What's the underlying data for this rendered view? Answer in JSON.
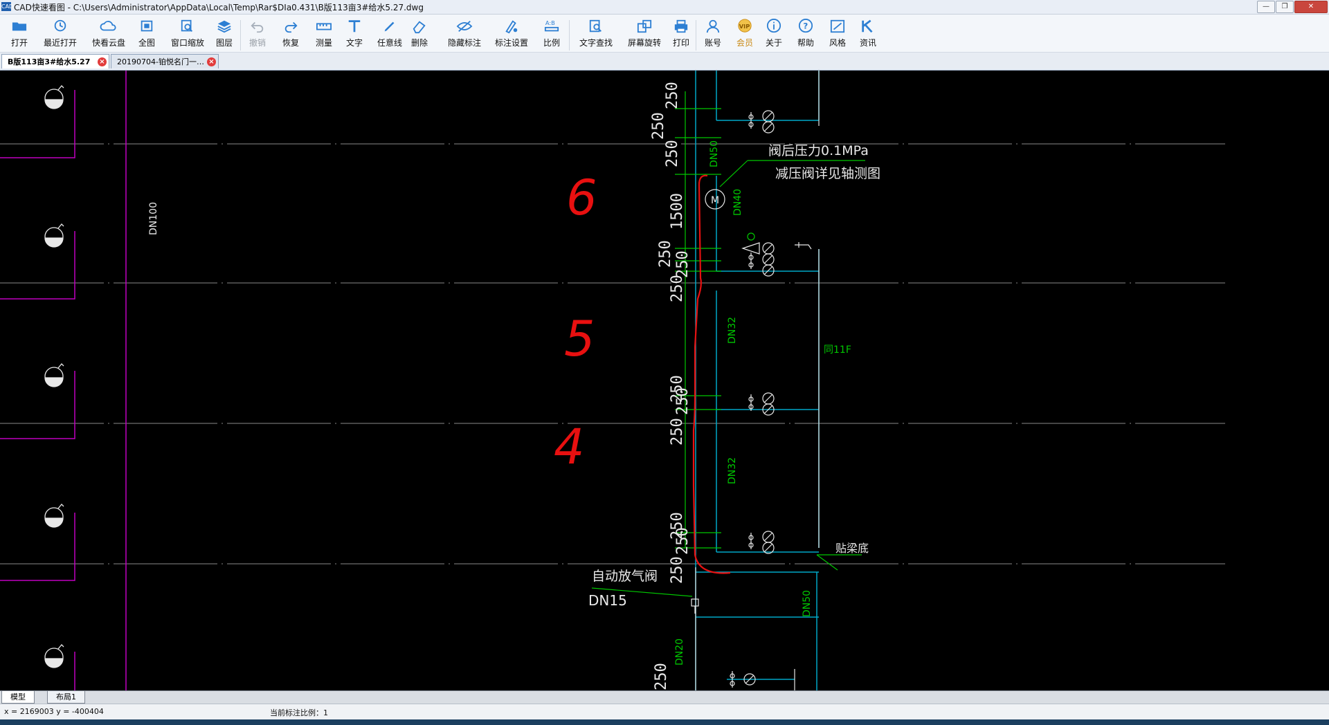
{
  "window": {
    "app_icon": "CAD",
    "title": "CAD快速看图 - C:\\Users\\Administrator\\AppData\\Local\\Temp\\Rar$DIa0.431\\B版113亩3#给水5.27.dwg",
    "buttons": {
      "minimize": "—",
      "restore": "❐",
      "close": "✕"
    }
  },
  "toolbar": [
    {
      "id": "open",
      "label": "打开",
      "icon": "folder-icon"
    },
    {
      "id": "recent",
      "label": "最近打开",
      "icon": "history-icon"
    },
    {
      "id": "cloud",
      "label": "快看云盘",
      "icon": "cloud-icon"
    },
    {
      "id": "fullview",
      "label": "全图",
      "icon": "fullview-icon"
    },
    {
      "id": "windowzoom",
      "label": "窗口缩放",
      "icon": "window-zoom-icon"
    },
    {
      "id": "layers",
      "label": "图层",
      "icon": "layers-icon"
    },
    {
      "id": "undo",
      "label": "撤销",
      "icon": "undo-icon",
      "disabled": true
    },
    {
      "id": "redo",
      "label": "恢复",
      "icon": "redo-icon"
    },
    {
      "id": "measure",
      "label": "测量",
      "icon": "ruler-icon"
    },
    {
      "id": "text",
      "label": "文字",
      "icon": "text-icon"
    },
    {
      "id": "freeline",
      "label": "任意线",
      "icon": "pen-icon"
    },
    {
      "id": "delete",
      "label": "删除",
      "icon": "eraser-icon"
    },
    {
      "id": "hidemark",
      "label": "隐藏标注",
      "icon": "eye-off-icon"
    },
    {
      "id": "marksettings",
      "label": "标注设置",
      "icon": "mark-settings-icon"
    },
    {
      "id": "scale",
      "label": "比例",
      "icon": "scale-icon"
    },
    {
      "id": "textsearch",
      "label": "文字查找",
      "icon": "text-search-icon"
    },
    {
      "id": "rotate",
      "label": "屏幕旋转",
      "icon": "rotate-icon"
    },
    {
      "id": "print",
      "label": "打印",
      "icon": "printer-icon"
    },
    {
      "id": "account",
      "label": "账号",
      "icon": "user-icon"
    },
    {
      "id": "vip",
      "label": "会员",
      "icon": "vip-icon",
      "badge": "VIP"
    },
    {
      "id": "about",
      "label": "关于",
      "icon": "info-icon"
    },
    {
      "id": "help",
      "label": "帮助",
      "icon": "help-icon"
    },
    {
      "id": "style",
      "label": "风格",
      "icon": "style-icon"
    },
    {
      "id": "news",
      "label": "资讯",
      "icon": "news-icon"
    }
  ],
  "tabs": [
    {
      "label": "B版113亩3#给水5.27",
      "active": true
    },
    {
      "label": "20190704-铂悦名门一…",
      "active": false
    }
  ],
  "drawing": {
    "left_pipe_label": "DN100",
    "dims": [
      "250",
      "250",
      "250",
      "1500",
      "250",
      "250",
      "250",
      "250",
      "250",
      "250",
      "250",
      "250",
      "250",
      "250"
    ],
    "pipe_labels": [
      "DN50",
      "DN40",
      "DN32",
      "DN32",
      "DN50",
      "DN20"
    ],
    "note_pressure": "阀后压力0.1MPa",
    "note_valve": "减压阀详见轴测图",
    "note_same": "同11F",
    "note_beam": "贴梁底",
    "note_airvalve": "自动放气阀",
    "note_dn15": "DN15",
    "meter_symbol": "M",
    "handwritten": [
      "6",
      "5",
      "4"
    ]
  },
  "layouts": [
    {
      "label": "模型",
      "active": true
    },
    {
      "label": "布局1",
      "active": false
    }
  ],
  "status": {
    "coords": "x = 2169003  y = -400404",
    "scale": "当前标注比例：1"
  },
  "colors": {
    "green": "#00c800",
    "cyan": "#00a8c8",
    "white": "#e8e8e8",
    "magenta": "#c000c0",
    "red": "#e81010",
    "grid": "#8a8a8a"
  }
}
